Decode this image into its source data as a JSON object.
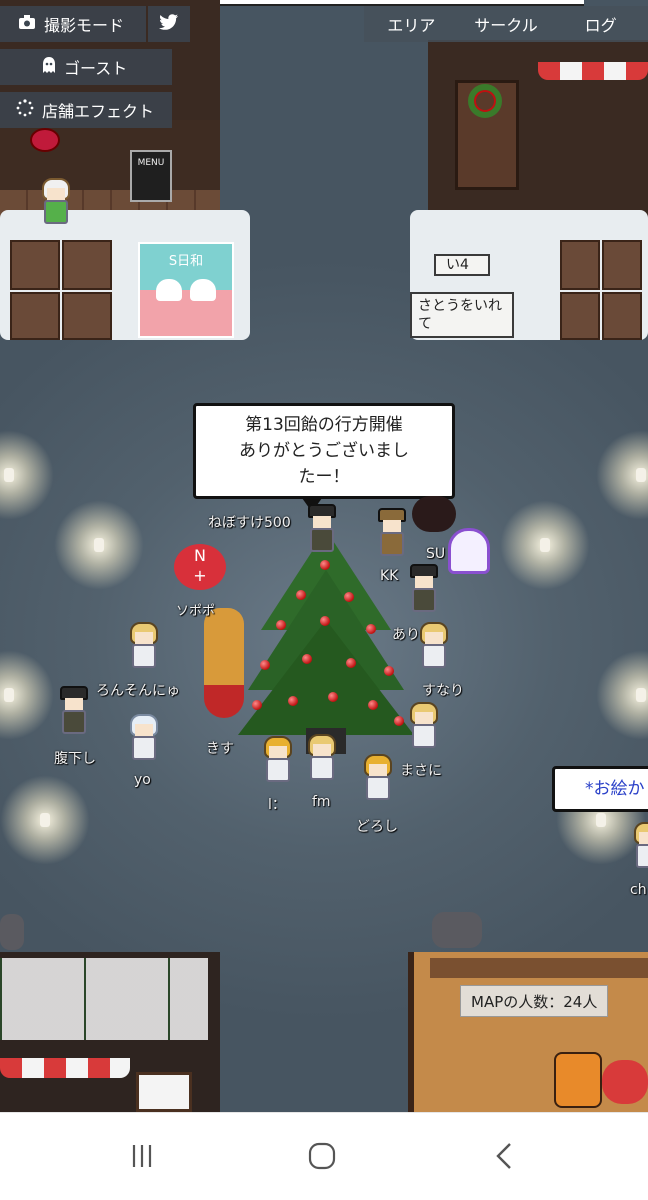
{
  "menu": {
    "photo_mode": "撮影モード",
    "ghost": "ゴースト",
    "shop_effect": "店舗エフェクト"
  },
  "top_nav": {
    "area": "エリア",
    "circle": "サークル",
    "log": "ログ"
  },
  "speech": {
    "main_line1": "第13回飴の行方開催",
    "main_line2": "ありがとうございまし",
    "main_line3": "たー！",
    "right_partial": "*お絵か"
  },
  "signs": {
    "menu_board": "MENU",
    "shop_sign": "S日和",
    "i4": "い4",
    "sato": "さとうをいれて"
  },
  "names": {
    "nebosuke": "ねぼすけ500",
    "su": "SU",
    "kk": "KK",
    "ari": "あり",
    "sonapo": "ソポポ",
    "ronsonnyu": "ろんそんにゅ",
    "sunari": "すなり",
    "harakudashi": "腹下し",
    "kisu": "きす",
    "masani": "まさに",
    "yo": "yo",
    "l_colon": "l：",
    "fm": "fm",
    "doroshi": "どろし",
    "ch": "ch"
  },
  "map_count": "MAPの人数：24人",
  "icons": [
    "camera-icon",
    "ghost-icon",
    "spinner-icon",
    "twitter-icon",
    "menu-lines-icon",
    "home-circle-icon",
    "back-chevron-icon"
  ],
  "colors": {
    "street": "#52616d",
    "menu_bg": "#3c4650",
    "ornament": "#c01010",
    "tree": "#2f6b2a"
  }
}
